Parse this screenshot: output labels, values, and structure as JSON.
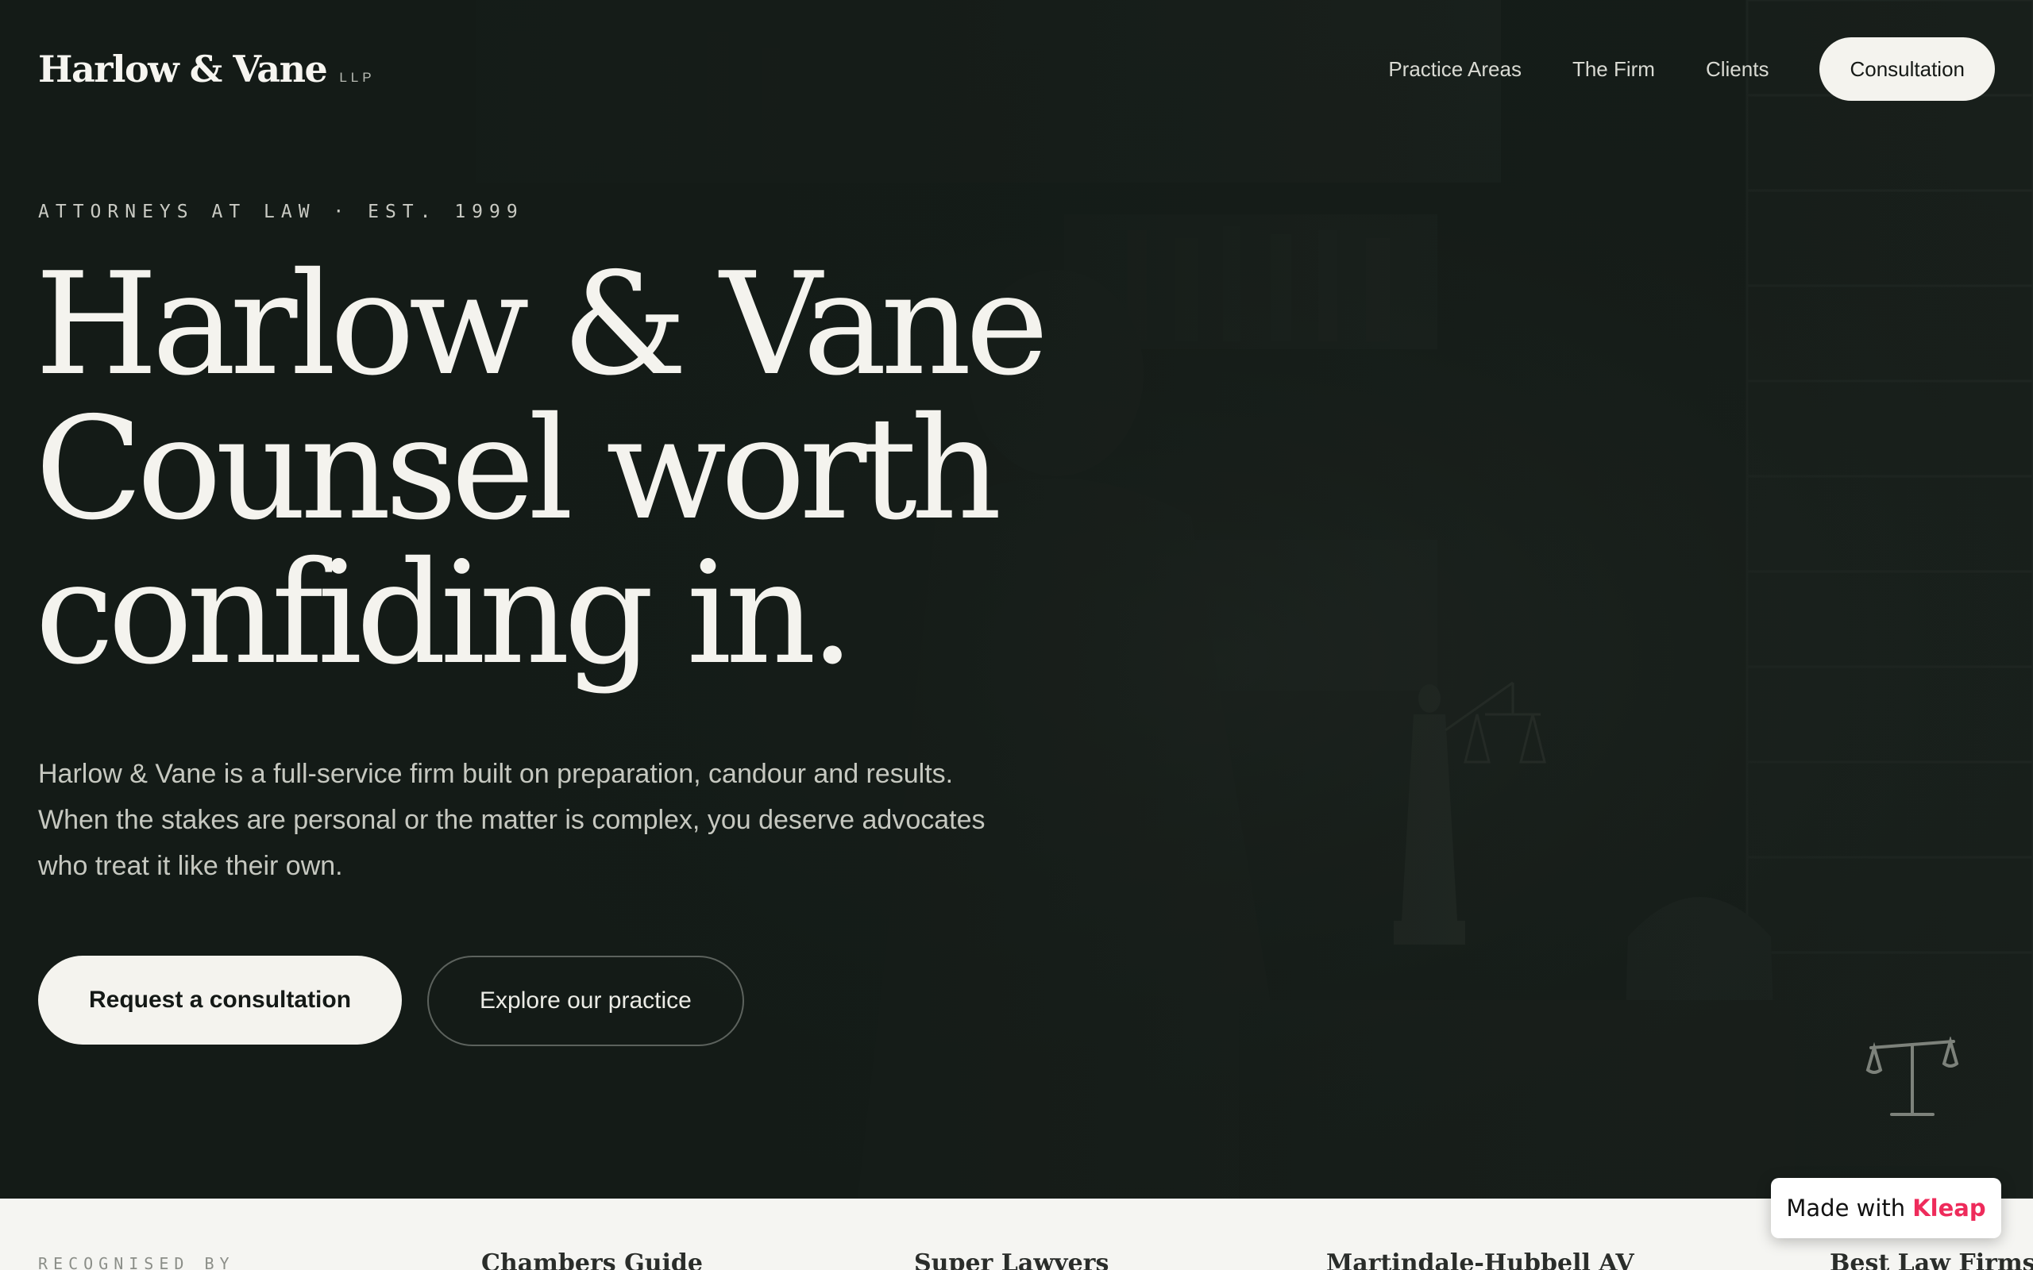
{
  "header": {
    "logo": "Harlow & Vane",
    "logo_suffix": "LLP",
    "nav": [
      "Practice Areas",
      "The Firm",
      "Clients"
    ],
    "cta": "Consultation"
  },
  "hero": {
    "eyebrow": "ATTORNEYS AT LAW · EST. 1999",
    "headline": [
      "Harlow & Vane",
      "Counsel worth",
      "confiding in."
    ],
    "lede": "Harlow & Vane is a full-service firm built on preparation, candour and results. When the stakes are personal or the matter is complex, you deserve advocates who treat it like their own.",
    "primary_cta": "Request a consultation",
    "secondary_cta": "Explore our practice",
    "icon": "scales-of-justice-icon"
  },
  "recognition": {
    "label": "RECOGNISED BY",
    "awards": [
      "Chambers Guide",
      "Super Lawyers",
      "Martindale-Hubbell AV",
      "Best Law Firms"
    ]
  },
  "badge": {
    "prefix": "Made with",
    "brand": "Kleap"
  },
  "colors": {
    "background": "#141b17",
    "text": "#f4f3ee",
    "button": "#f4f3ee",
    "badge_brand": "#ee2b5b"
  }
}
